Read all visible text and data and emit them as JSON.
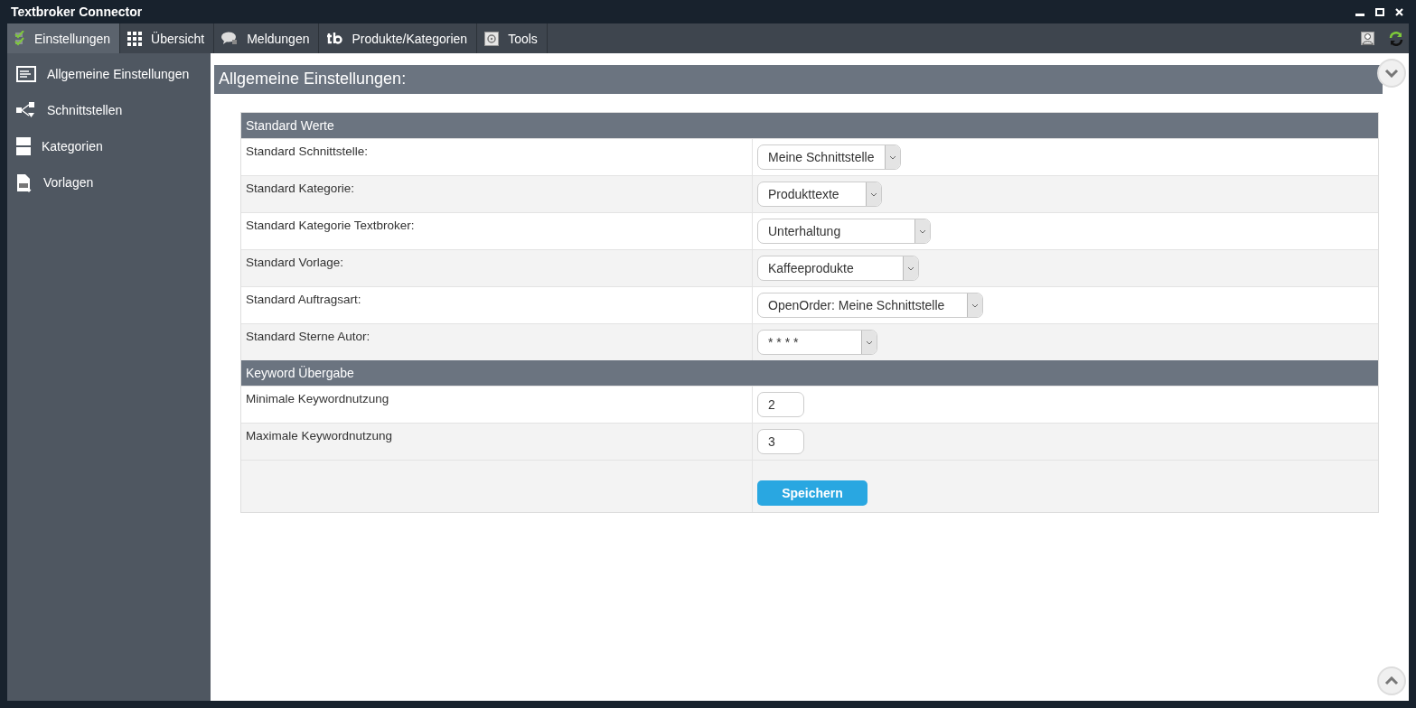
{
  "window": {
    "title": "Textbroker Connector"
  },
  "tabs": [
    {
      "label": "Einstellungen",
      "selected": true
    },
    {
      "label": "Übersicht",
      "selected": false
    },
    {
      "label": "Meldungen",
      "selected": false
    },
    {
      "label": "Produkte/Kategorien",
      "selected": false
    },
    {
      "label": "Tools",
      "selected": false
    }
  ],
  "sidebar": {
    "items": [
      {
        "label": "Allgemeine Einstellungen"
      },
      {
        "label": "Schnittstellen"
      },
      {
        "label": "Kategorien"
      },
      {
        "label": "Vorlagen"
      }
    ]
  },
  "heading": "Allgemeine Einstellungen:",
  "sections": [
    {
      "title": "Standard Werte",
      "rows": [
        {
          "kind": "select",
          "label": "Standard Schnittstelle:",
          "value": "Meine Schnittstelle"
        },
        {
          "kind": "select",
          "label": "Standard Kategorie:",
          "value": "Produkttexte"
        },
        {
          "kind": "select",
          "label": "Standard Kategorie Textbroker:",
          "value": "Unterhaltung"
        },
        {
          "kind": "select",
          "label": "Standard Vorlage:",
          "value": "Kaffeeprodukte"
        },
        {
          "kind": "select",
          "label": "Standard Auftragsart:",
          "value": "OpenOrder: Meine Schnittstelle"
        },
        {
          "kind": "select",
          "label": "Standard Sterne Autor:",
          "value": "* * * *"
        }
      ]
    },
    {
      "title": "Keyword Übergabe",
      "rows": [
        {
          "kind": "input",
          "label": "Minimale Keywordnutzung",
          "value": "2"
        },
        {
          "kind": "input",
          "label": "Maximale Keywordnutzung",
          "value": "3"
        }
      ]
    }
  ],
  "save_button": "Speichern"
}
